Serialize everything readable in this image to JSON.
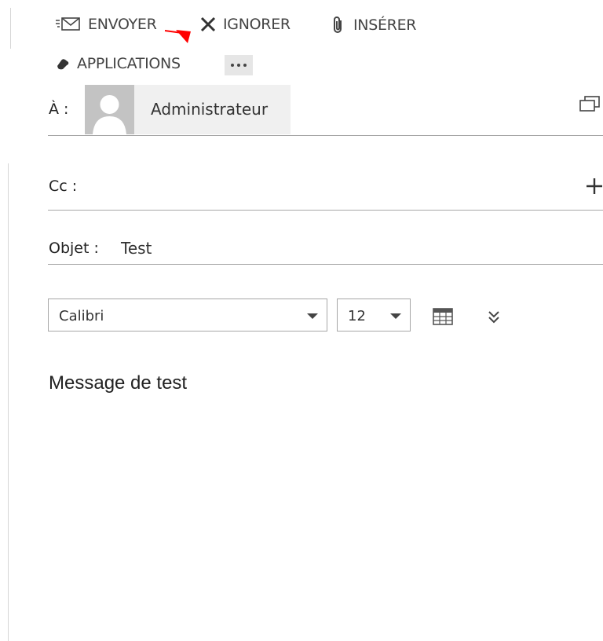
{
  "toolbar": {
    "send_label": "ENVOYER",
    "discard_label": "IGNORER",
    "insert_label": "INSÉRER",
    "apps_label": "APPLICATIONS",
    "more_label": "•••"
  },
  "to": {
    "label": "À :",
    "recipient": "Administrateur"
  },
  "cc": {
    "label": "Cc :"
  },
  "subject": {
    "label": "Objet :",
    "value": "Test"
  },
  "format": {
    "font": "Calibri",
    "size": "12"
  },
  "body": {
    "text": "Message de test"
  },
  "colors": {
    "annotation_arrow": "#ff0000",
    "chip_bg": "#f0f0f0",
    "avatar_bg": "#c3c3c3"
  }
}
